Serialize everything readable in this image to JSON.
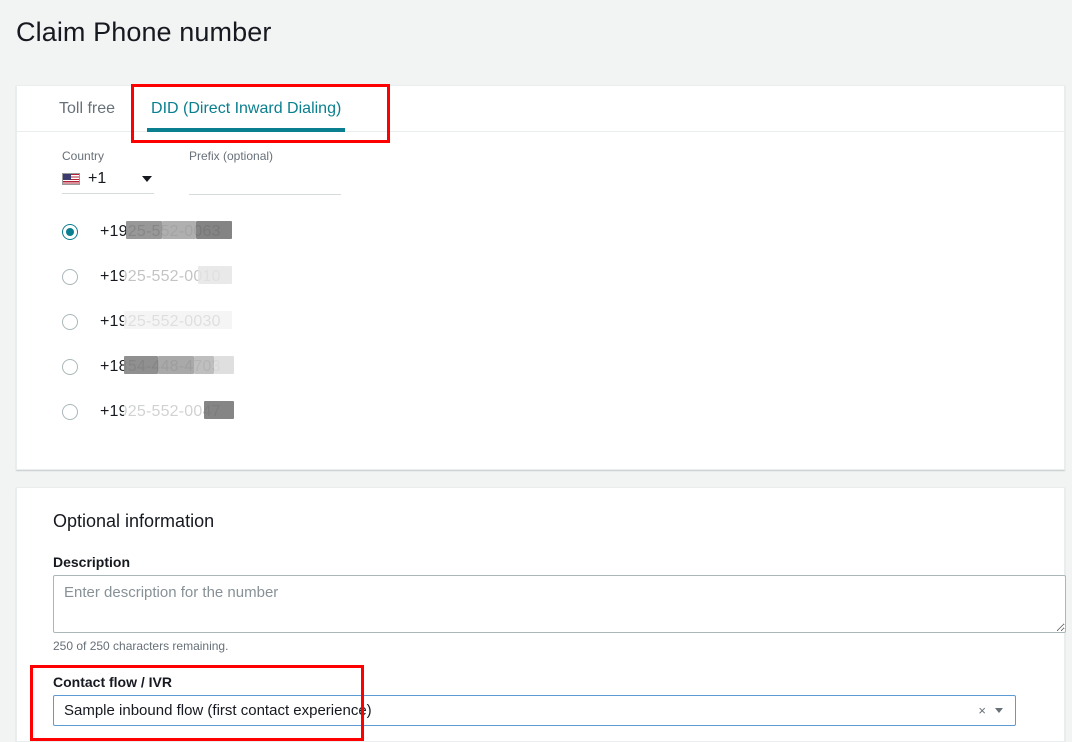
{
  "page": {
    "title": "Claim Phone number"
  },
  "tabs": [
    {
      "label": "Toll free",
      "active": false
    },
    {
      "label": "DID (Direct Inward Dialing)",
      "active": true
    }
  ],
  "filters": {
    "country_label": "Country",
    "country_value": "+1",
    "country_flag_icon": "us-flag-icon",
    "prefix_label": "Prefix (optional)",
    "prefix_value": "",
    "prefix_placeholder": ""
  },
  "numbers": {
    "country_prefix": "+1",
    "items": [
      {
        "digits": "925-552-0063",
        "selected": true
      },
      {
        "digits": "925-552-0010",
        "selected": false
      },
      {
        "digits": "925-552-0030",
        "selected": false
      },
      {
        "digits": "854-448-4703",
        "selected": false
      },
      {
        "digits": "925-552-0047",
        "selected": false
      }
    ]
  },
  "optional": {
    "section_title": "Optional information",
    "description_label": "Description",
    "description_value": "",
    "description_placeholder": "Enter description for the number",
    "char_hint": "250 of 250 characters remaining.",
    "contact_flow_label": "Contact flow / IVR",
    "contact_flow_value": "Sample inbound flow (first contact experience)",
    "clear_icon": "×",
    "caret_icon": "chevron-down-icon"
  },
  "colors": {
    "accent_teal": "#0a7f8f",
    "annotation_red": "#ff0000",
    "focus_blue": "#5d9bd4",
    "page_bg": "#f2f3f3"
  }
}
